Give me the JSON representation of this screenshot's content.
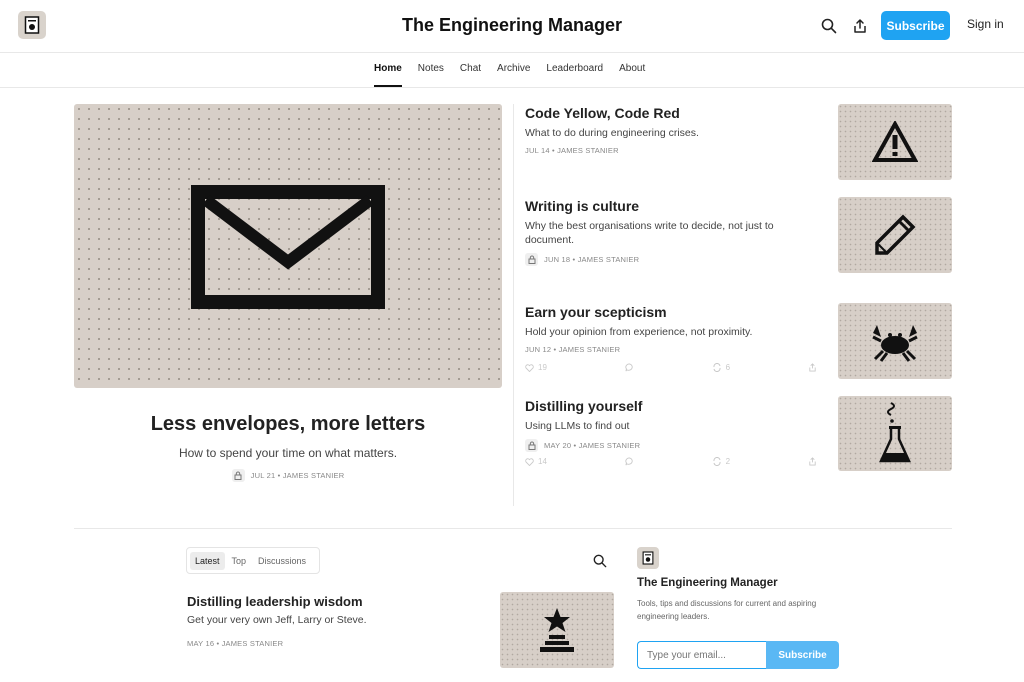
{
  "header": {
    "title": "The Engineering Manager",
    "subscribe_label": "Subscribe",
    "signin_label": "Sign in"
  },
  "nav": {
    "items": [
      "Home",
      "Notes",
      "Chat",
      "Archive",
      "Leaderboard",
      "About"
    ],
    "active": "Home"
  },
  "hero": {
    "title": "Less envelopes, more letters",
    "subtitle": "How to spend your time on what matters.",
    "meta": "JUL 21 • JAMES STANIER",
    "image_icon": "envelope-icon"
  },
  "posts": [
    {
      "title": "Code Yellow, Code Red",
      "subtitle": "What to do during engineering crises.",
      "meta": "JUL 14 • JAMES STANIER",
      "locked": false,
      "thumb_icon": "warning-icon"
    },
    {
      "title": "Writing is culture",
      "subtitle": "Why the best organisations write to decide, not just to document.",
      "meta": "JUN 18 • JAMES STANIER",
      "locked": true,
      "thumb_icon": "pencil-icon"
    },
    {
      "title": "Earn your scepticism",
      "subtitle": "Hold your opinion from experience, not proximity.",
      "meta": "JUN 12 • JAMES STANIER",
      "locked": false,
      "thumb_icon": "crab-icon",
      "likes": "19",
      "restacks": "6"
    },
    {
      "title": "Distilling yourself",
      "subtitle": "Using LLMs to find out",
      "meta": "MAY 20 • JAMES STANIER",
      "locked": true,
      "thumb_icon": "flask-icon",
      "likes": "14",
      "restacks": "2"
    }
  ],
  "feed": {
    "tabs": [
      "Latest",
      "Top",
      "Discussions"
    ],
    "active_tab": "Latest",
    "post": {
      "title": "Distilling leadership wisdom",
      "subtitle": "Get your very own Jeff, Larry or Steve.",
      "meta": "MAY 16 • JAMES STANIER",
      "thumb_icon": "trophy-star-icon"
    }
  },
  "sidebar": {
    "title": "The Engineering Manager",
    "description": "Tools, tips and discussions for current and aspiring engineering leaders.",
    "email_placeholder": "Type your email...",
    "subscribe_label": "Subscribe"
  },
  "colors": {
    "accent": "#1fa3f2",
    "thumb_bg": "#d7cfc8"
  }
}
